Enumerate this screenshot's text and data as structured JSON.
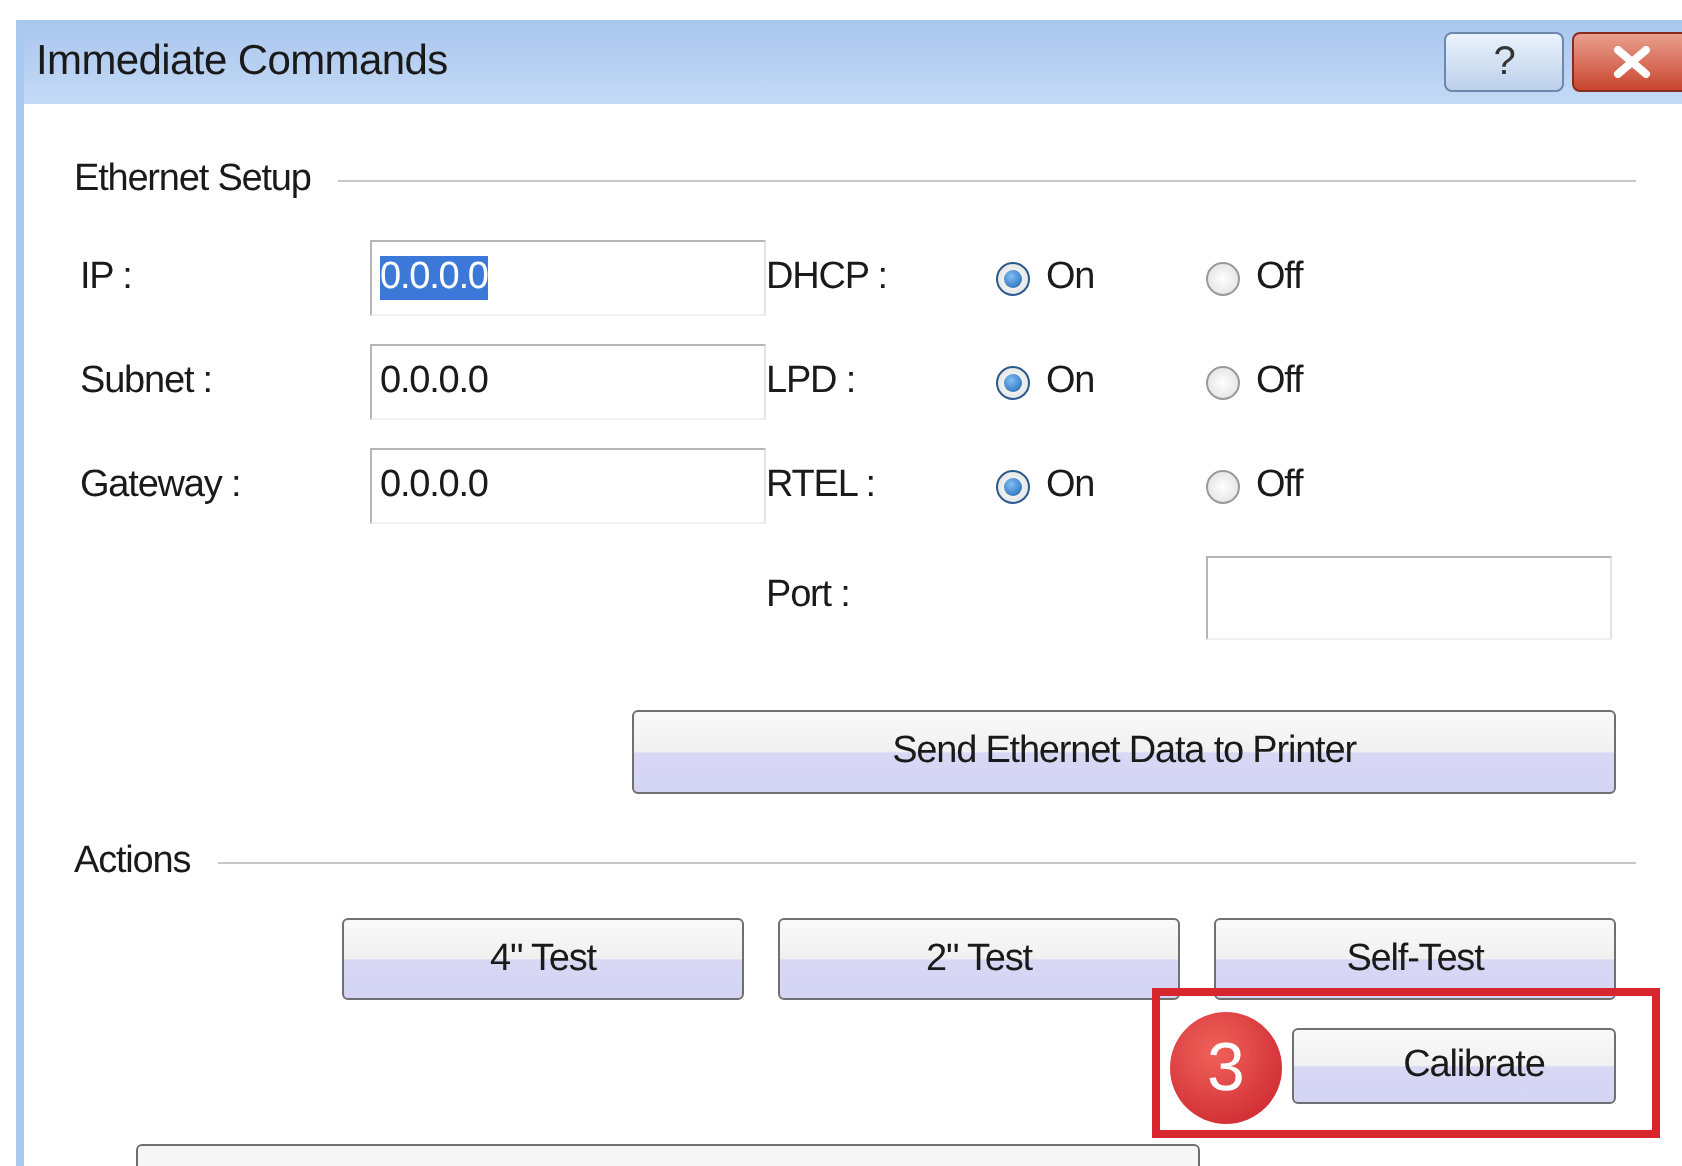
{
  "window": {
    "title": "Immediate Commands",
    "help_button": "?"
  },
  "ethernet_setup": {
    "title": "Ethernet Setup",
    "fields": [
      {
        "label": "IP :",
        "value": "0.0.0.0",
        "highlighted": true
      },
      {
        "label": "Subnet :",
        "value": "0.0.0.0",
        "highlighted": false
      },
      {
        "label": "Gateway :",
        "value": "0.0.0.0",
        "highlighted": false
      }
    ],
    "options": [
      {
        "label": "DHCP :",
        "choices": [
          {
            "label": "On",
            "selected": true
          },
          {
            "label": "Off",
            "selected": false
          }
        ]
      },
      {
        "label": "LPD :",
        "choices": [
          {
            "label": "On",
            "selected": true
          },
          {
            "label": "Off",
            "selected": false
          }
        ]
      },
      {
        "label": "RTEL :",
        "choices": [
          {
            "label": "On",
            "selected": true
          },
          {
            "label": "Off",
            "selected": false
          }
        ]
      }
    ],
    "port": {
      "label": "Port :"
    },
    "send_button": "Send Ethernet Data to Printer"
  },
  "actions": {
    "title": "Actions",
    "test_buttons": [
      "4\" Test",
      "2\" Test",
      "Self-Test"
    ],
    "calibrate_button": "Calibrate"
  },
  "callout": {
    "number": "3"
  }
}
